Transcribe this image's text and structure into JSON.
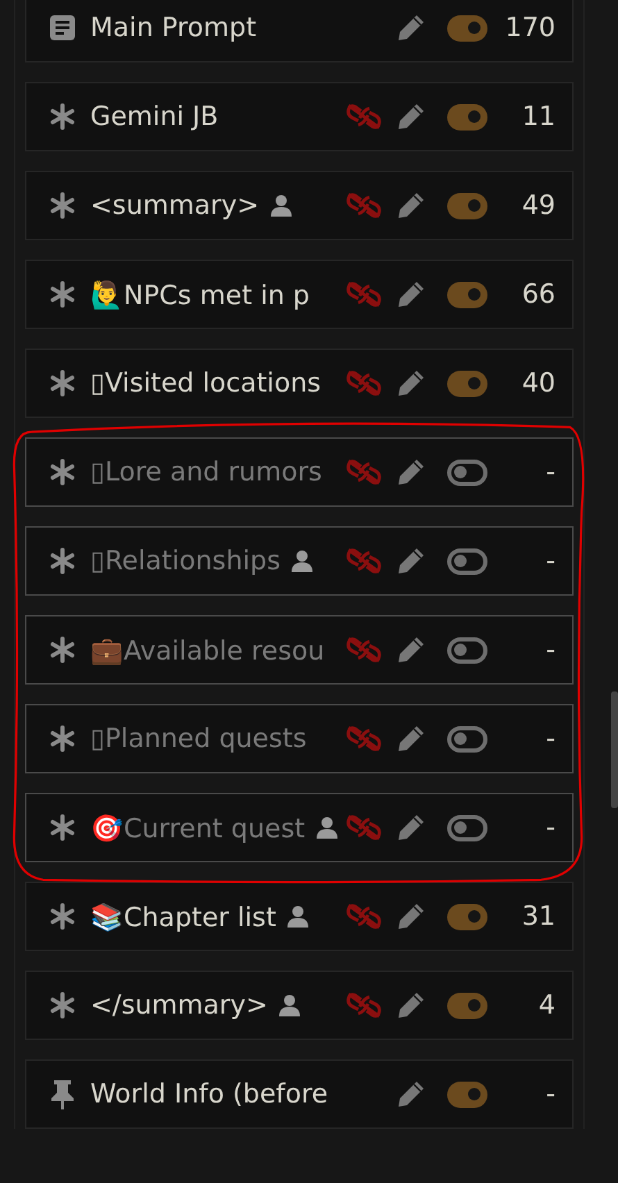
{
  "prompts": [
    {
      "kind": "document",
      "name": "Main Prompt",
      "user": false,
      "unlinked": false,
      "on": true,
      "count": "170",
      "circled": false
    },
    {
      "kind": "asterisk",
      "name": "Gemini JB",
      "user": false,
      "unlinked": true,
      "on": true,
      "count": "11",
      "circled": false
    },
    {
      "kind": "asterisk",
      "name": "<summary>",
      "user": true,
      "unlinked": true,
      "on": true,
      "count": "49",
      "circled": false
    },
    {
      "kind": "asterisk",
      "name": "🙋‍♂NPCs met in p",
      "user": false,
      "unlinked": true,
      "on": true,
      "count": "66",
      "circled": false
    },
    {
      "kind": "asterisk",
      "name": "▯Visited locations",
      "user": false,
      "unlinked": true,
      "on": true,
      "count": "40",
      "circled": false
    },
    {
      "kind": "asterisk",
      "name": "▯Lore and rumors",
      "user": false,
      "unlinked": true,
      "on": false,
      "count": "-",
      "circled": true
    },
    {
      "kind": "asterisk",
      "name": "▯Relationships",
      "user": true,
      "unlinked": true,
      "on": false,
      "count": "-",
      "circled": true
    },
    {
      "kind": "asterisk",
      "name": "💼Available resou",
      "user": false,
      "unlinked": true,
      "on": false,
      "count": "-",
      "circled": true
    },
    {
      "kind": "asterisk",
      "name": "▯Planned quests",
      "user": false,
      "unlinked": true,
      "on": false,
      "count": "-",
      "circled": true
    },
    {
      "kind": "asterisk",
      "name": "🎯Current quest",
      "user": true,
      "unlinked": true,
      "on": false,
      "count": "-",
      "circled": true
    },
    {
      "kind": "asterisk",
      "name": "📚Chapter list",
      "user": true,
      "unlinked": true,
      "on": true,
      "count": "31",
      "circled": false
    },
    {
      "kind": "asterisk",
      "name": "</summary>",
      "user": true,
      "unlinked": true,
      "on": true,
      "count": "4",
      "circled": false
    },
    {
      "kind": "pin",
      "name": "World Info (before",
      "user": false,
      "unlinked": false,
      "on": true,
      "count": "-",
      "circled": false
    }
  ]
}
